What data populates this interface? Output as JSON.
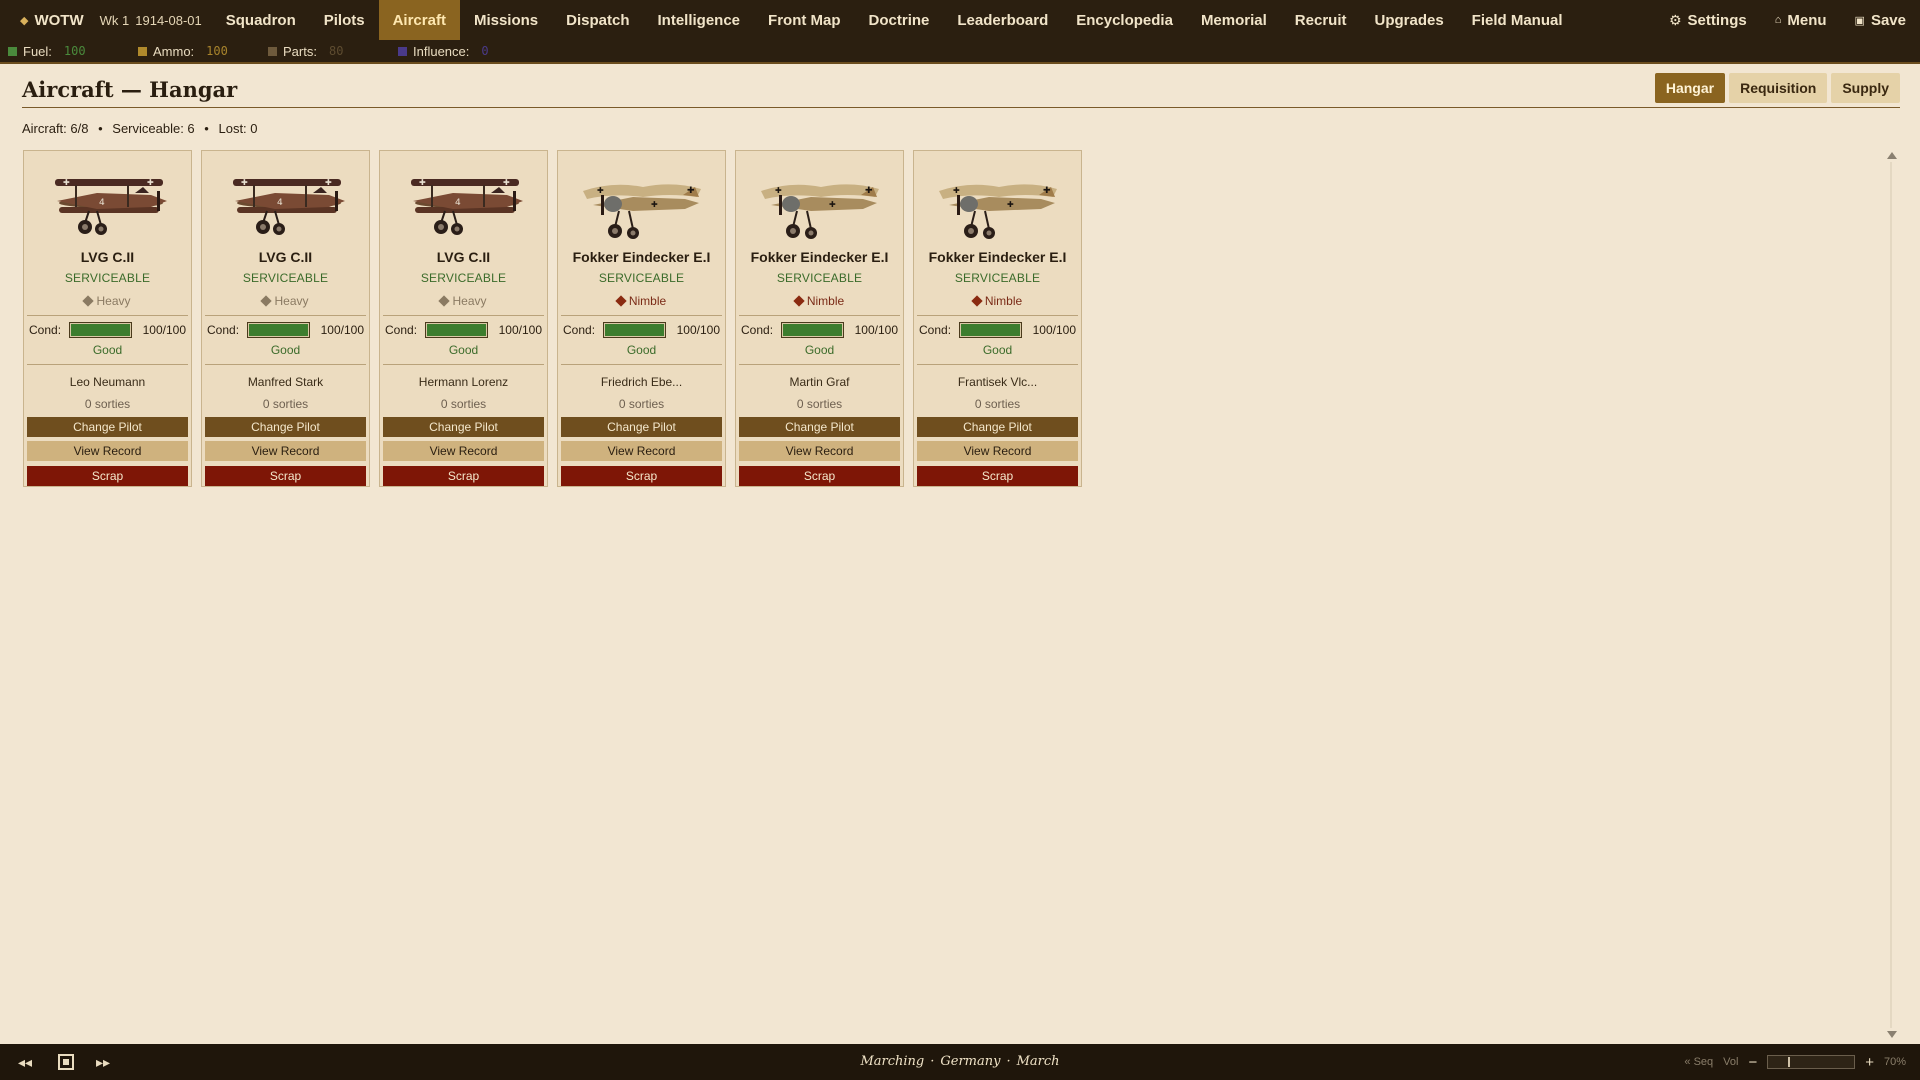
{
  "brand": {
    "icon": "diamond-icon",
    "label": "WOTW"
  },
  "week": {
    "label": "Wk 1",
    "date": "1914-08-01"
  },
  "nav": {
    "items": [
      {
        "label": "Squadron"
      },
      {
        "label": "Pilots"
      },
      {
        "label": "Aircraft",
        "active": true
      },
      {
        "label": "Missions"
      },
      {
        "label": "Dispatch"
      },
      {
        "label": "Intelligence"
      },
      {
        "label": "Front Map"
      },
      {
        "label": "Doctrine"
      },
      {
        "label": "Leaderboard"
      },
      {
        "label": "Encyclopedia"
      },
      {
        "label": "Memorial"
      },
      {
        "label": "Recruit"
      },
      {
        "label": "Upgrades"
      },
      {
        "label": "Field Manual"
      }
    ],
    "settings": "Settings",
    "menu": "Menu",
    "save": "Save"
  },
  "resources": [
    {
      "label": "Fuel:",
      "value": "100",
      "color": "#4a8a3c",
      "value_color": "#4a8a3c"
    },
    {
      "label": "Ammo:",
      "value": "100",
      "color": "#b08a2c",
      "value_color": "#a8842c"
    },
    {
      "label": "Parts:",
      "value": "80",
      "color": "#6e5a3c",
      "value_color": "#5e4c30"
    },
    {
      "label": "Influence:",
      "value": "0",
      "color": "#4a3a8a",
      "value_color": "#4a3a8a"
    }
  ],
  "page": {
    "title": "Aircraft — Hangar",
    "tabs": [
      {
        "label": "Hangar",
        "active": true
      },
      {
        "label": "Requisition"
      },
      {
        "label": "Supply"
      }
    ],
    "stats": {
      "aircraft": "Aircraft: 6/8",
      "serviceable": "Serviceable: 6",
      "lost": "Lost: 0",
      "sep": "•"
    }
  },
  "aircraft": [
    {
      "name": "LVG C.II",
      "status": "SERVICEABLE",
      "trait": "Heavy",
      "trait_type": "heavy",
      "cond_label": "Cond:",
      "cond": "100/100",
      "cond_fraction": 1.0,
      "cond_text": "Good",
      "pilot": "Leo Neumann",
      "sorties": "0 sorties",
      "plane": "biplane"
    },
    {
      "name": "LVG C.II",
      "status": "SERVICEABLE",
      "trait": "Heavy",
      "trait_type": "heavy",
      "cond_label": "Cond:",
      "cond": "100/100",
      "cond_fraction": 1.0,
      "cond_text": "Good",
      "pilot": "Manfred Stark",
      "sorties": "0 sorties",
      "plane": "biplane"
    },
    {
      "name": "LVG C.II",
      "status": "SERVICEABLE",
      "trait": "Heavy",
      "trait_type": "heavy",
      "cond_label": "Cond:",
      "cond": "100/100",
      "cond_fraction": 1.0,
      "cond_text": "Good",
      "pilot": "Hermann Lorenz",
      "sorties": "0 sorties",
      "plane": "biplane"
    },
    {
      "name": "Fokker Eindecker E.I",
      "status": "SERVICEABLE",
      "trait": "Nimble",
      "trait_type": "nimble",
      "cond_label": "Cond:",
      "cond": "100/100",
      "cond_fraction": 1.0,
      "cond_text": "Good",
      "pilot": "Friedrich Ebe...",
      "sorties": "0 sorties",
      "plane": "monoplane"
    },
    {
      "name": "Fokker Eindecker E.I",
      "status": "SERVICEABLE",
      "trait": "Nimble",
      "trait_type": "nimble",
      "cond_label": "Cond:",
      "cond": "100/100",
      "cond_fraction": 1.0,
      "cond_text": "Good",
      "pilot": "Martin Graf",
      "sorties": "0 sorties",
      "plane": "monoplane"
    },
    {
      "name": "Fokker Eindecker E.I",
      "status": "SERVICEABLE",
      "trait": "Nimble",
      "trait_type": "nimble",
      "cond_label": "Cond:",
      "cond": "100/100",
      "cond_fraction": 1.0,
      "cond_text": "Good",
      "pilot": "Frantisek Vlc...",
      "sorties": "0 sorties",
      "plane": "monoplane"
    }
  ],
  "card_buttons": {
    "change": "Change Pilot",
    "record": "View Record",
    "scrap": "Scrap"
  },
  "footer": {
    "location": [
      "Marching",
      "Germany",
      "March"
    ],
    "dot": "·",
    "seq": "« Seq",
    "vol": "Vol",
    "minus": "−",
    "plus": "+",
    "volume_percent": "70%",
    "volume_fraction": 0.7
  }
}
